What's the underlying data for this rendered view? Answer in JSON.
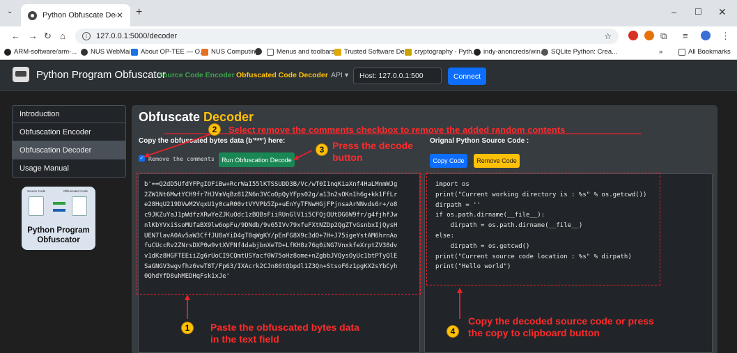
{
  "browser": {
    "tab_title": "Python Obfuscate Decoder",
    "url": "127.0.0.1:5000/decoder",
    "bookmarks": [
      {
        "label": "ARM-software/arm-...",
        "color": "#222"
      },
      {
        "label": "NUS WebMail",
        "color": "#333"
      },
      {
        "label": "About OP-TEE — O...",
        "color": "#1a73e8"
      },
      {
        "label": "NUS Computing",
        "color": "#e37222"
      },
      {
        "label": "",
        "color": "#333"
      },
      {
        "label": "Menus and toolbars...",
        "color": "#555"
      },
      {
        "label": "Trusted Software De...",
        "color": "#e0a800"
      },
      {
        "label": "cryptography - Pyth...",
        "color": "#c9a400"
      },
      {
        "label": "indy-anoncreds/win...",
        "color": "#222"
      },
      {
        "label": "SQLite Python: Crea...",
        "color": "#555"
      }
    ],
    "all_bookmarks_label": "All Bookmarks",
    "overflow_label": "»"
  },
  "navbar": {
    "brand": "Python Program Obfuscator",
    "encoder_link": "Source Code Encoder",
    "decoder_link": "Obfuscated Code Decoder",
    "api_label": "API ▾",
    "host_value": "Host: 127.0.0.1:500",
    "connect_label": "Connect"
  },
  "sidebar": {
    "items": [
      {
        "label": "Introduction"
      },
      {
        "label": "Obfuscation Encoder"
      },
      {
        "label": "Obfuscation Decoder"
      },
      {
        "label": "Usage Manual"
      }
    ],
    "logo": {
      "source_label": "Source Code",
      "obf_label": "Obfuscated Code",
      "name_line1": "Python Program",
      "name_line2": "Obfuscator"
    }
  },
  "main": {
    "title_prefix": "Obfuscate",
    "title_highlight": "Decoder",
    "copy_label": "Copy the obfuscated bytes data (b'***') here:",
    "remove_comments_label": "Remove the comments",
    "run_button": "Run Obfuscation Decode",
    "orig_label": "Orignal Python Source Code :",
    "copy_code_button": "Copy Code",
    "remove_code_button": "Remove Code",
    "obfuscated_text": "b'==Q2dD5UfdYFPgIOFiBw+RcrWaI55lKTSSUDD3B/Vc/wT0I1nqKiaXnf4HaLMnmWJg\n2ZW1Nt6MwtYCH9fr7HJVmVqBz81ZN6n3VCoOpQyYFps02g/a13n2sOKn1h6g+kk1FfLr\ne28HqU219DVwM2VqxU1y0caR00vtVYVPb5Zp+uEnYyTFNwHGjFPjnsaArNNvds6r+/o8\nc9JKZuYaJ1pWdfzXRwYeZJKuOdc1zBQBsFiiRUnGlV1i5CFQjQUtDG6W9fr/g4fjhfJw\nnlKbYVxiSsoMUfaBX9lw6opFu/9DNdb/9v65IVv79xfuFXtNZDp2QgZTvGsnbxIjQysH\nUEN7lavA0Av5aW3CffJU8aYiD4gT0qWgKY/pEnFG8X9c3dO+7H+J75igeYstAM6hrnAo\nfuCUccRv2ZNrsDXP0w9vtXVFNf4dabjbnXeTD+LfKH8z76q0iNG7VnxkfeXrptZV38dv\nv1dKz8HGFTEEiiZg6rUoCI9CQmtUSYacf0W75oHz8ome+nZgbbJVQysOyUc1btPTyQlE\nSaGNGV3wgvfhz6vwT8T/Fp63/IXAcrk2CJn86tQbpdl1Z3Qn+StsoF6z1pgKX2sYbCyh\n0QhdYfD8uhMEDHqFsk1xJe'",
    "source_code": "import os\nprint(\"Current working directory is : %s\" % os.getcwd())\ndirpath = ''\nif os.path.dirname(__file__):\n    dirpath = os.path.dirname(__file__)\nelse:\n    dirpath = os.getcwd()\nprint(\"Current source code location : %s\" % dirpath)\nprint(\"Hello world\")"
  },
  "annotations": {
    "step1_num": "1",
    "step1_line1": "Paste the obfuscated bytes data",
    "step1_line2": "in the text field",
    "step2_num": "2",
    "step2_text": "Select remove the comments checkbox to remove the added random contents",
    "step3_num": "3",
    "step3_line1": "Press the decode",
    "step3_line2": "button",
    "step4_num": "4",
    "step4_line1": "Copy the decoded source code or press",
    "step4_line2": "the copy to clipboard button",
    "color": "#e8232a"
  }
}
